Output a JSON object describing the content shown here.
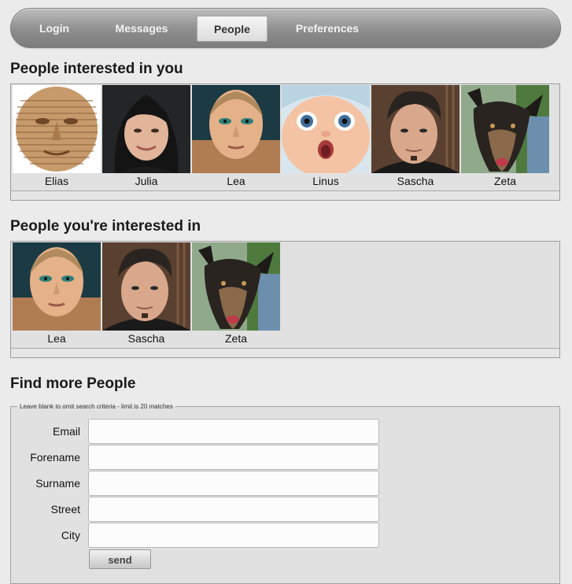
{
  "nav": {
    "items": [
      {
        "label": "Login"
      },
      {
        "label": "Messages"
      },
      {
        "label": "People"
      },
      {
        "label": "Preferences"
      }
    ],
    "active": "People"
  },
  "interested_in_you": {
    "heading": "People interested in you",
    "people": [
      {
        "name": "Elias"
      },
      {
        "name": "Julia"
      },
      {
        "name": "Lea"
      },
      {
        "name": "Linus"
      },
      {
        "name": "Sascha"
      },
      {
        "name": "Zeta"
      }
    ]
  },
  "you_interested_in": {
    "heading": "People you're interested in",
    "people": [
      {
        "name": "Lea"
      },
      {
        "name": "Sascha"
      },
      {
        "name": "Zeta"
      }
    ]
  },
  "find_more": {
    "heading": "Find more People",
    "legend": "Leave blank to omit search criteria - limit is 20 matches",
    "fields": [
      {
        "label": "Email",
        "value": ""
      },
      {
        "label": "Forename",
        "value": ""
      },
      {
        "label": "Surname",
        "value": ""
      },
      {
        "label": "Street",
        "value": ""
      },
      {
        "label": "City",
        "value": ""
      }
    ],
    "send_label": "send"
  }
}
